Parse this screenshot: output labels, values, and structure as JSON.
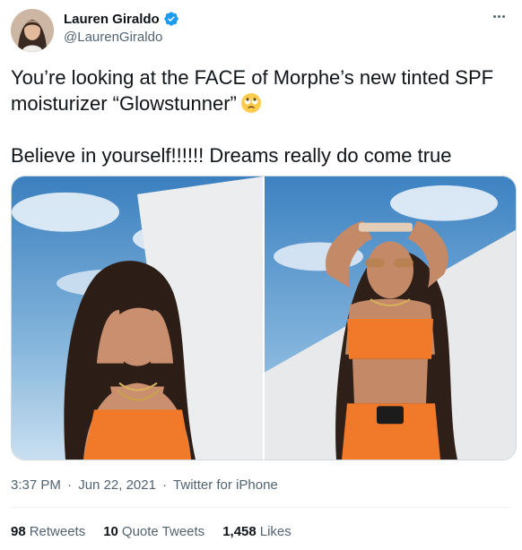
{
  "user": {
    "display_name": "Lauren Giraldo",
    "handle": "@LaurenGiraldo",
    "verified": true
  },
  "tweet": {
    "line1": "You’re looking at the FACE of Morphe’s new tinted SPF",
    "line2": "moisturizer “Glowstunner”",
    "line2_emoji": "eye-roll-emoji",
    "line3": "Believe in yourself!!!!!! Dreams really do come true"
  },
  "media": {
    "photos": [
      "photo-1",
      "photo-2"
    ]
  },
  "meta": {
    "time": "3:37 PM",
    "date": "Jun 22, 2021",
    "source": "Twitter for iPhone",
    "separator": "·"
  },
  "stats": {
    "retweets_count": "98",
    "retweets_label": "Retweets",
    "quotes_count": "10",
    "quotes_label": "Quote Tweets",
    "likes_count": "1,458",
    "likes_label": "Likes"
  },
  "colors": {
    "text": "#0f1419",
    "secondary": "#536471",
    "verified": "#1d9bf0",
    "border": "#cfd9de"
  }
}
